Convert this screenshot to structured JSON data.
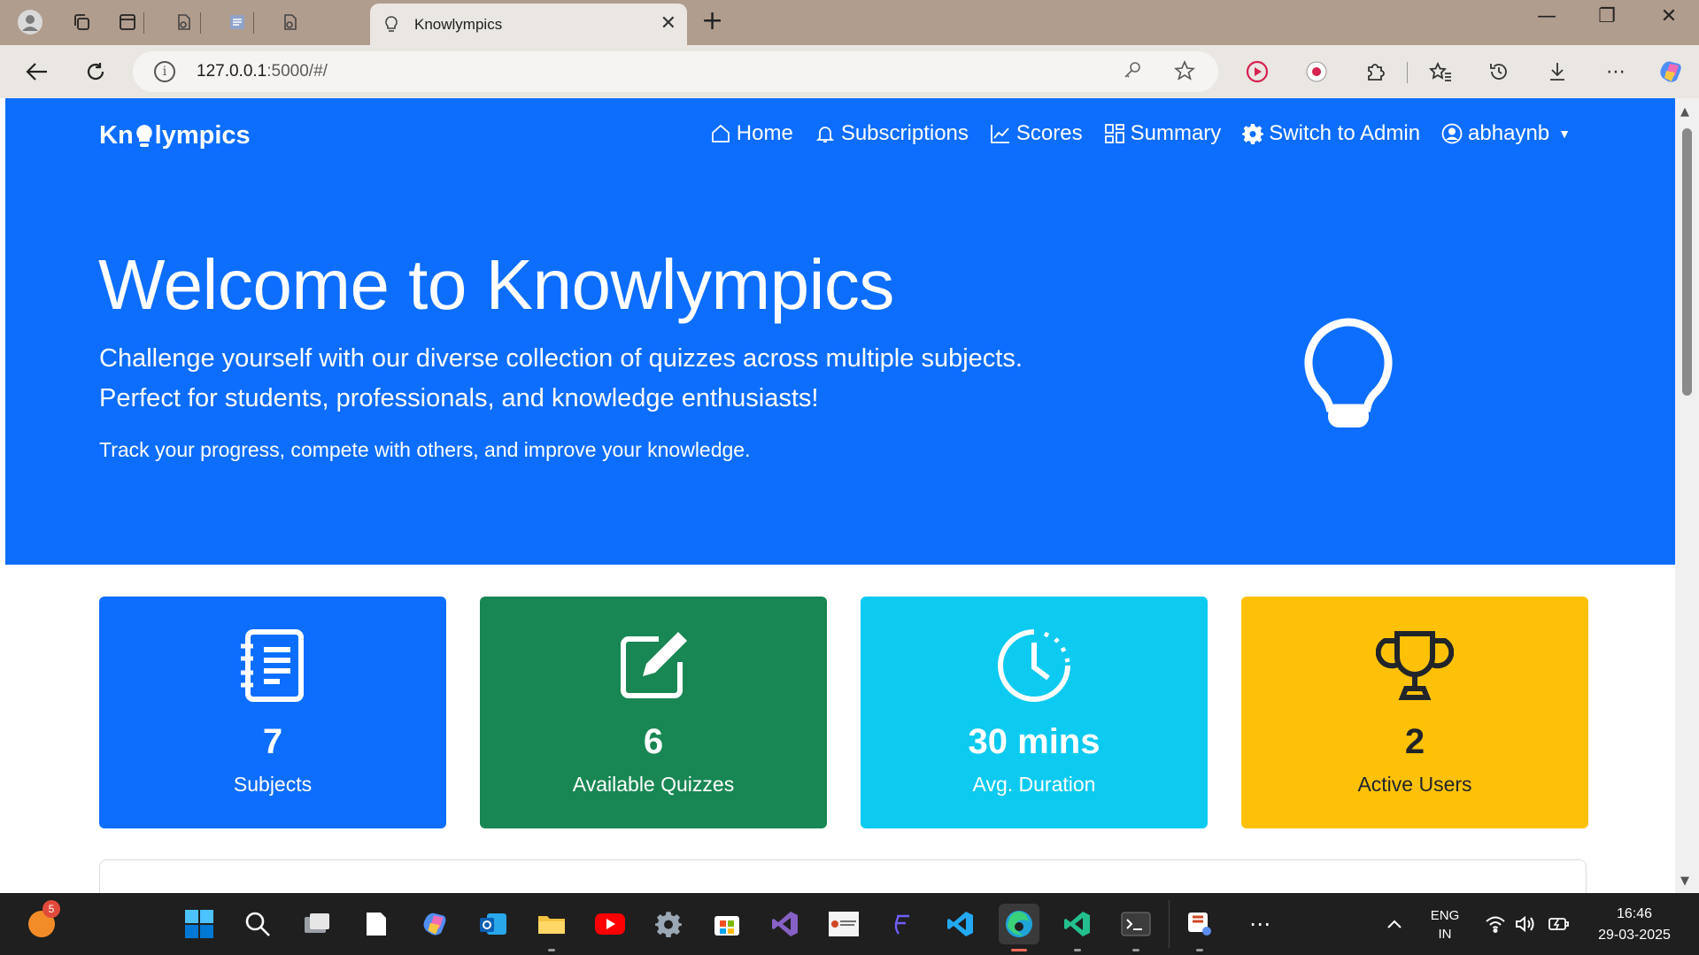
{
  "browser": {
    "tab_title": "Knowlympics",
    "url_host": "127.0.0.1",
    "url_rest": ":5000/#/"
  },
  "navbar": {
    "brand_prefix": "Kn",
    "brand_suffix": "lympics",
    "items": [
      {
        "label": "Home",
        "icon": "house-icon"
      },
      {
        "label": "Subscriptions",
        "icon": "bell-icon"
      },
      {
        "label": "Scores",
        "icon": "graph-icon"
      },
      {
        "label": "Summary",
        "icon": "grid-icon"
      },
      {
        "label": "Switch to Admin",
        "icon": "gear-icon"
      },
      {
        "label": "abhaynb",
        "icon": "user-circle-icon"
      }
    ]
  },
  "hero": {
    "title": "Welcome to Knowlympics",
    "lead": "Challenge yourself with our diverse collection of quizzes across multiple subjects. Perfect for students, professionals, and knowledge enthusiasts!",
    "sub": "Track your progress, compete with others, and improve your knowledge."
  },
  "stats": [
    {
      "value": "7",
      "label": "Subjects",
      "color": "#0d6efd",
      "text_color": "#ffffff",
      "icon": "journal-icon"
    },
    {
      "value": "6",
      "label": "Available Quizzes",
      "color": "#198754",
      "text_color": "#ffffff",
      "icon": "pencil-square-icon"
    },
    {
      "value": "30 mins",
      "label": "Avg. Duration",
      "color": "#0dcaf0",
      "text_color": "#ffffff",
      "icon": "clock-icon"
    },
    {
      "value": "2",
      "label": "Active Users",
      "color": "#ffc107",
      "text_color": "#212529",
      "icon": "trophy-icon"
    }
  ],
  "taskbar": {
    "notification_count": "5",
    "language": "ENG",
    "region": "IN",
    "time": "16:46",
    "date": "29-03-2025"
  }
}
